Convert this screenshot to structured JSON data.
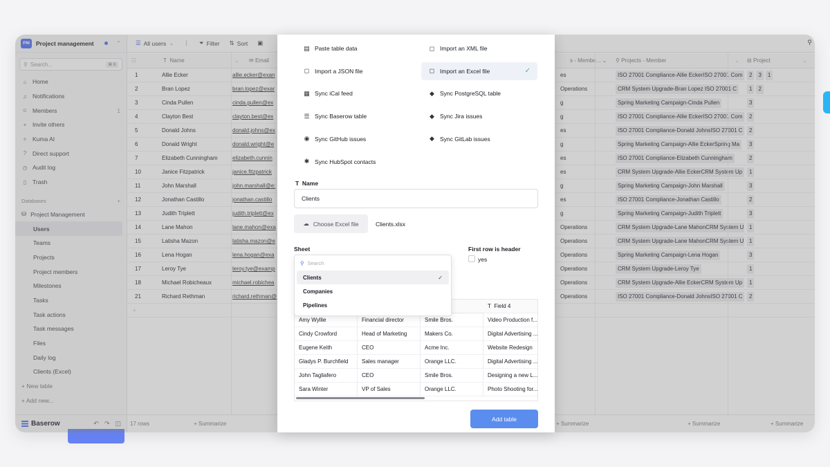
{
  "workspace": {
    "badge": "PM",
    "name": "Project management"
  },
  "sidebar": {
    "search_placeholder": "Search...",
    "search_kbd": "⌘ K",
    "nav": [
      {
        "label": "Home",
        "icon": "home-icon",
        "glyph": "⌂"
      },
      {
        "label": "Notifications",
        "icon": "bell-icon",
        "glyph": "♫"
      },
      {
        "label": "Members",
        "icon": "members-icon",
        "glyph": "☺",
        "count": "1"
      },
      {
        "label": "Invite others",
        "icon": "invite-icon",
        "glyph": "+"
      },
      {
        "label": "Kuma AI",
        "icon": "ai-icon",
        "glyph": "✧"
      },
      {
        "label": "Direct support",
        "icon": "support-icon",
        "glyph": "?"
      },
      {
        "label": "Audit log",
        "icon": "audit-icon",
        "glyph": "◷"
      },
      {
        "label": "Trash",
        "icon": "trash-icon",
        "glyph": "▯"
      }
    ],
    "databases_label": "Databases",
    "database_name": "Project Management",
    "tables": [
      "Users",
      "Teams",
      "Projects",
      "Project members",
      "Milestones",
      "Tasks",
      "Task actions",
      "Task messages",
      "Files",
      "Daily log",
      "Clients (Excel)"
    ],
    "active_table": "Users",
    "new_table": "+ New table",
    "add_new": "+ Add new...",
    "brand": "Baserow"
  },
  "toolbar": {
    "view": "All users",
    "filter": "Filter",
    "sort": "Sort"
  },
  "grid": {
    "headers": {
      "name": "Name",
      "email": "Email",
      "teams_member": "s - Membe...",
      "projects_member": "Projects - Member",
      "project": "Project"
    },
    "rows": [
      {
        "id": "1",
        "name": "Allie Ecker",
        "email": "allie.ecker@exan",
        "team": "es",
        "proj": "ISO 27001 Compliance-Allie EckerISO 27001 Com",
        "p": [
          "2",
          "3",
          "1"
        ]
      },
      {
        "id": "2",
        "name": "Bran Lopez",
        "email": "bran.lopez@exar",
        "team": "Operations",
        "proj": "CRM System Upgrade-Bran Lopez   ISO 27001 C",
        "p": [
          "1",
          "2"
        ]
      },
      {
        "id": "3",
        "name": "Cinda Pullen",
        "email": "cinda.pullen@ex",
        "team": "g",
        "proj": "Spring Marketing Campaign-Cinda Pullen",
        "p": [
          "3"
        ]
      },
      {
        "id": "4",
        "name": "Clayton Best",
        "email": "clayton.best@ex",
        "team": "g",
        "proj": "ISO 27001 Compliance-Allie EckerISO 27001 Com",
        "p": [
          "2"
        ]
      },
      {
        "id": "5",
        "name": "Donald Johns",
        "email": "donald.johns@ex",
        "team": "es",
        "proj": "ISO 27001 Compliance-Donald JohnsISO 27001 C",
        "p": [
          "2"
        ]
      },
      {
        "id": "6",
        "name": "Donald Wright",
        "email": "donald.wright@e",
        "team": "g",
        "proj": "Spring Marketing Campaign-Allie EckerSpring Ma",
        "p": [
          "3"
        ]
      },
      {
        "id": "7",
        "name": "Elizabeth Cunningham",
        "email": "elizabeth.cunnin",
        "team": "es",
        "proj": "ISO 27001 Compliance-Elizabeth Cunningham",
        "p": [
          "2"
        ]
      },
      {
        "id": "10",
        "name": "Janice Fitzpatrick",
        "email": "janice.fitzpatrick",
        "team": "es",
        "proj": "CRM System Upgrade-Allie EckerCRM System Up",
        "p": [
          "1"
        ]
      },
      {
        "id": "11",
        "name": "John Marshall",
        "email": "john.marshall@e:",
        "team": "g",
        "proj": "Spring Marketing Campaign-John Marshall",
        "p": [
          "3"
        ]
      },
      {
        "id": "12",
        "name": "Jonathan Castillo",
        "email": "jonathan.castillo",
        "team": "es",
        "proj": "ISO 27001 Compliance-Jonathan Castillo",
        "p": [
          "2"
        ]
      },
      {
        "id": "13",
        "name": "Judith Triplett",
        "email": "judith.triplett@ex",
        "team": "g",
        "proj": "Spring Marketing Campaign-Judith Triplett",
        "p": [
          "3"
        ]
      },
      {
        "id": "14",
        "name": "Lane Mahon",
        "email": "lane.mahon@exa",
        "team": "Operations",
        "proj": "CRM System Upgrade-Lane MahonCRM System U",
        "p": [
          "1"
        ]
      },
      {
        "id": "15",
        "name": "Latisha Mazon",
        "email": "latisha.mazon@e",
        "team": "Operations",
        "proj": "CRM System Upgrade-Lane MahonCRM System U",
        "p": [
          "1"
        ]
      },
      {
        "id": "16",
        "name": "Lena Hogan",
        "email": "lena.hogan@exa",
        "team": "Operations",
        "proj": "Spring Marketing Campaign-Lena Hogan",
        "p": [
          "3"
        ]
      },
      {
        "id": "17",
        "name": "Leroy Tye",
        "email": "leroy.tye@examp",
        "team": "Operations",
        "proj": "CRM System Upgrade-Leroy Tye",
        "p": [
          "1"
        ]
      },
      {
        "id": "18",
        "name": "Michael Robicheaux",
        "email": "michael.robichea",
        "team": "Operations",
        "proj": "CRM System Upgrade-Allie EckerCRM System Up",
        "p": [
          "1"
        ]
      },
      {
        "id": "21",
        "name": "Richard Rethman",
        "email": "richard.rethman@",
        "team": "Operations",
        "proj": "ISO 27001 Compliance-Donald JohnsISO 27001 C",
        "p": [
          "2"
        ]
      }
    ],
    "row_count": "17 rows",
    "summarize": "Summarize"
  },
  "modal": {
    "sources": [
      {
        "label": "Paste table data",
        "icon": "clipboard-icon",
        "glyph": "▤"
      },
      {
        "label": "Import an XML file",
        "icon": "xml-file-icon",
        "glyph": "◻"
      },
      {
        "label": "Import a JSON file",
        "icon": "json-file-icon",
        "glyph": "◻"
      },
      {
        "label": "Import an Excel file",
        "icon": "excel-file-icon",
        "glyph": "◻",
        "selected": true
      },
      {
        "label": "Sync iCal feed",
        "icon": "calendar-icon",
        "glyph": "▦"
      },
      {
        "label": "Sync PostgreSQL table",
        "icon": "postgresql-icon",
        "glyph": "◆"
      },
      {
        "label": "Sync Baserow table",
        "icon": "baserow-icon",
        "glyph": "☰"
      },
      {
        "label": "Sync Jira issues",
        "icon": "jira-icon",
        "glyph": "◆"
      },
      {
        "label": "Sync GitHub issues",
        "icon": "github-icon",
        "glyph": "◉"
      },
      {
        "label": "Sync GitLab issues",
        "icon": "gitlab-icon",
        "glyph": "◆"
      },
      {
        "label": "Sync HubSpot contacts",
        "icon": "hubspot-icon",
        "glyph": "✱"
      }
    ],
    "name_label": "Name",
    "name_value": "Clients",
    "choose_label": "Choose Excel file",
    "file_name": "Clients.xlsx",
    "sheet_label": "Sheet",
    "first_row_label": "First row is header",
    "first_row_option": "yes",
    "dropdown": {
      "search_placeholder": "Search",
      "options": [
        "Clients",
        "Companies",
        "Pipelines"
      ],
      "selected": "Clients"
    },
    "preview": {
      "field4_header": "Field 4",
      "rows": [
        [
          "Amy Wyllie",
          "Financial director",
          "Smile Bros.",
          "Video Production f..."
        ],
        [
          "Cindy Crowford",
          "Head of Marketing",
          "Makers Co.",
          "Digital Advertising ..."
        ],
        [
          "Eugene Keith",
          "CEO",
          "Acme Inc.",
          "Website Redesign"
        ],
        [
          "Gladys P. Burchfield",
          "Sales manager",
          "Orange LLC.",
          "Digital Advertising ..."
        ],
        [
          "John Tagliafero",
          "CEO",
          "Smile Bros.",
          "Designing a new L..."
        ],
        [
          "Sara Winter",
          "VP of Sales",
          "Orange LLC.",
          "Photo Shooting for..."
        ]
      ]
    },
    "add_button": "Add table"
  }
}
